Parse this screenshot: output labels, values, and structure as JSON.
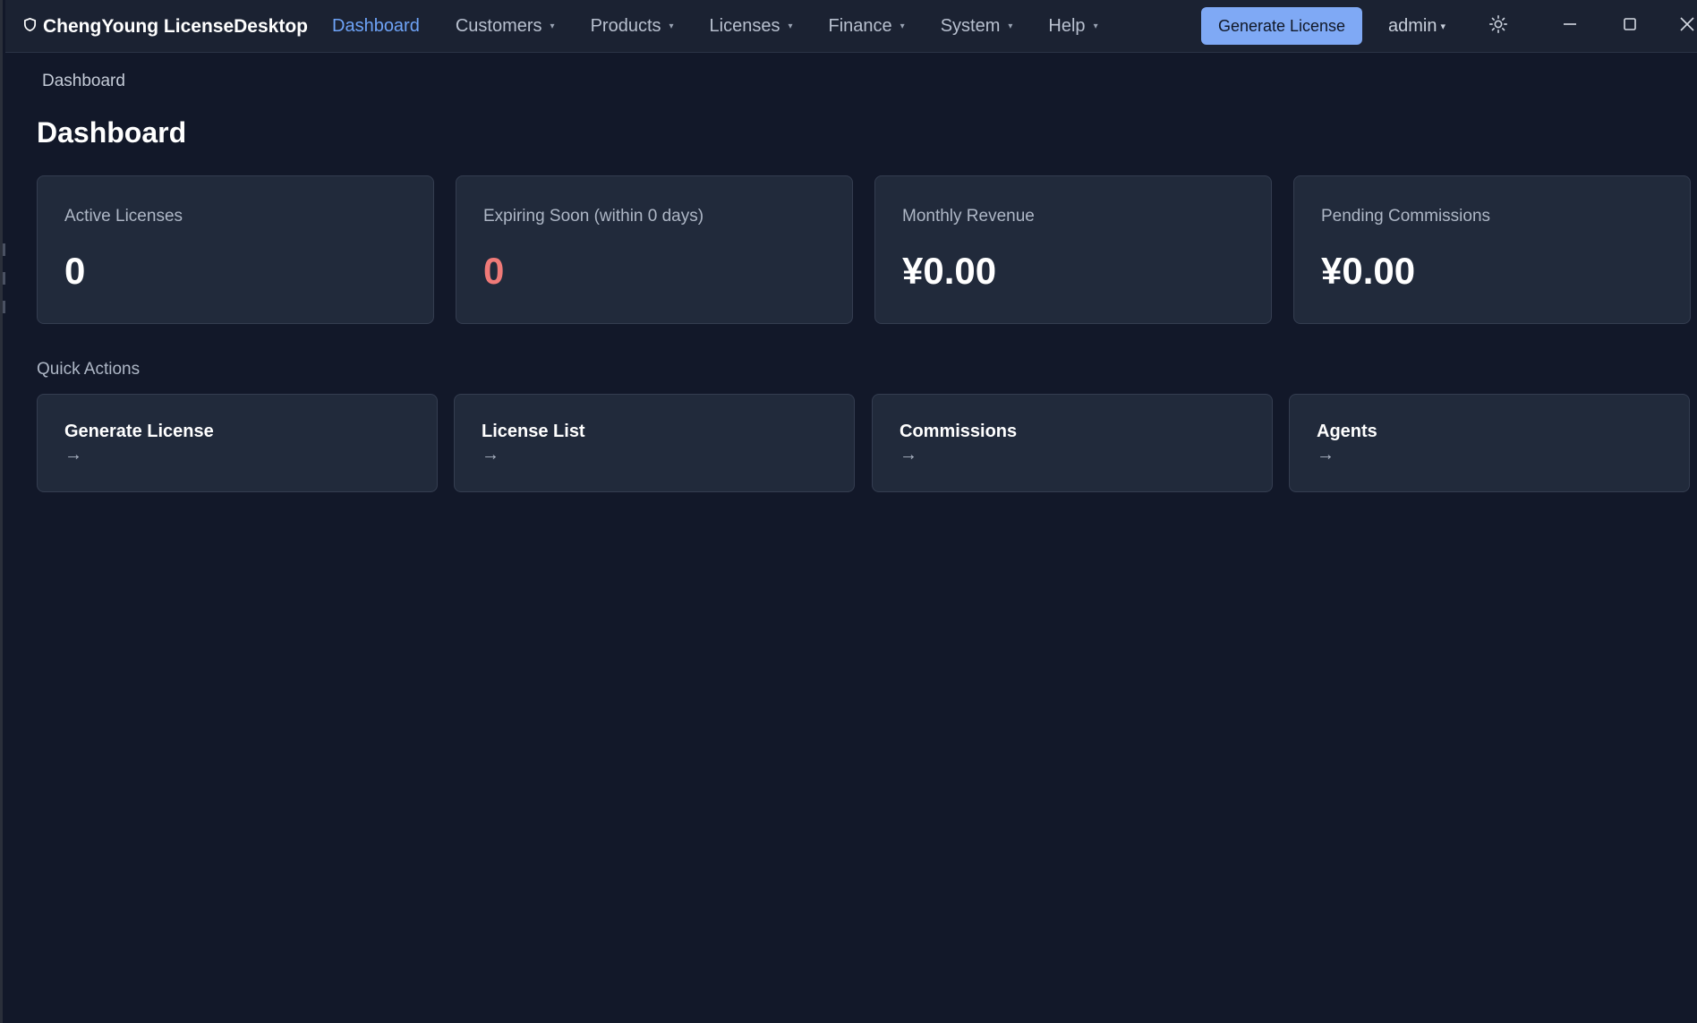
{
  "app": {
    "title": "ChengYoung LicenseDesktop",
    "icon": "shield-icon"
  },
  "nav": {
    "items": [
      {
        "label": "Dashboard",
        "active": true,
        "has_dropdown": false
      },
      {
        "label": "Customers",
        "active": false,
        "has_dropdown": true
      },
      {
        "label": "Products",
        "active": false,
        "has_dropdown": true
      },
      {
        "label": "Licenses",
        "active": false,
        "has_dropdown": true
      },
      {
        "label": "Finance",
        "active": false,
        "has_dropdown": true
      },
      {
        "label": "System",
        "active": false,
        "has_dropdown": true
      },
      {
        "label": "Help",
        "active": false,
        "has_dropdown": true
      }
    ],
    "caret": "▾"
  },
  "toolbar": {
    "generate_label": "Generate License",
    "user_label": "admin",
    "theme_icon": "sun-icon"
  },
  "window_controls": [
    "minimize-icon",
    "maximize-icon",
    "close-icon"
  ],
  "breadcrumb": "Dashboard",
  "page": {
    "title": "Dashboard"
  },
  "stats": [
    {
      "label": "Active Licenses",
      "value": "0",
      "tone": "normal"
    },
    {
      "label": "Expiring Soon (within 0 days)",
      "value": "0",
      "tone": "danger"
    },
    {
      "label": "Monthly Revenue",
      "value": "¥0.00",
      "tone": "normal"
    },
    {
      "label": "Pending Commissions",
      "value": "¥0.00",
      "tone": "normal"
    }
  ],
  "quick_actions": {
    "label": "Quick Actions",
    "arrow": "→",
    "items": [
      {
        "title": "Generate License"
      },
      {
        "title": "License List"
      },
      {
        "title": "Commissions"
      },
      {
        "title": "Agents"
      }
    ]
  },
  "colors": {
    "background": "#121829",
    "topbar": "#1b2232",
    "card": "#212a3b",
    "accent": "#6ea3f7",
    "button": "#7fa9f5",
    "danger": "#f07a78"
  }
}
